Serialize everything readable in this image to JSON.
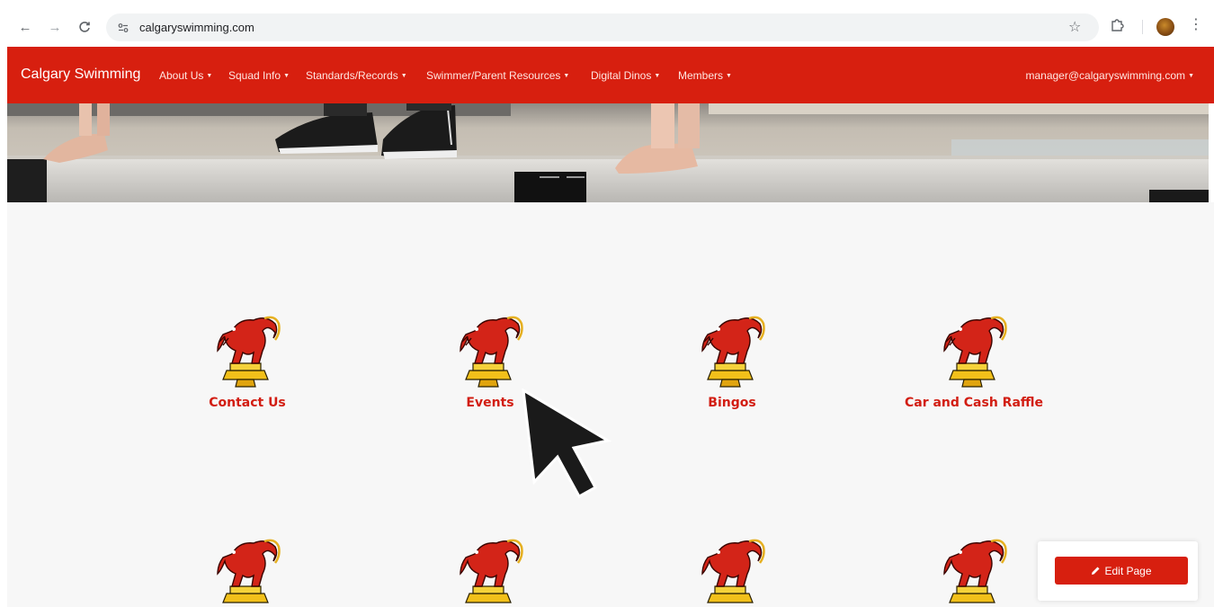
{
  "browser": {
    "back_icon": "←",
    "forward_icon": "→",
    "reload_icon": "C",
    "site_info_icon": "⚙",
    "url": "calgaryswimming.com",
    "star_icon": "☆",
    "kebab_icon": "⋮"
  },
  "navbar": {
    "brand": "Calgary Swimming",
    "menu": [
      {
        "label": "About Us"
      },
      {
        "label": "Squad Info"
      },
      {
        "label": "Standards/Records"
      },
      {
        "label": "Swimmer/Parent Resources"
      },
      {
        "label": "Digital Dinos"
      },
      {
        "label": "Members"
      }
    ],
    "caret": "▼",
    "user": "manager@calgaryswimming.com",
    "color": "#d71f0f"
  },
  "tiles": [
    {
      "label": "Contact Us",
      "icon": "dinosaur-logo-icon"
    },
    {
      "label": "Events",
      "icon": "dinosaur-logo-icon"
    },
    {
      "label": "Bingos",
      "icon": "dinosaur-logo-icon"
    },
    {
      "label": "Car and Cash Raffle",
      "icon": "dinosaur-logo-icon"
    },
    {
      "label": "",
      "icon": "dinosaur-logo-icon"
    },
    {
      "label": "",
      "icon": "dinosaur-logo-icon"
    },
    {
      "label": "",
      "icon": "dinosaur-logo-icon"
    },
    {
      "label": "",
      "icon": "dinosaur-logo-icon"
    }
  ],
  "edit_button": {
    "label": "Edit Page",
    "icon": "pencil-icon"
  },
  "accent_color": "#d21d12"
}
